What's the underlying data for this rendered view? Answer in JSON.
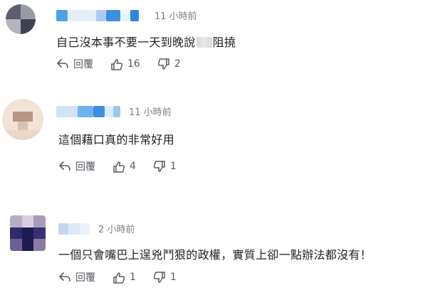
{
  "comments": [
    {
      "time": "11 小時前",
      "text_before": "自己沒本事不要一天到晚說",
      "text_after": "阻撓",
      "reply_label": "回覆",
      "likes": "16",
      "dislikes": "2"
    },
    {
      "time": "11 小時前",
      "text": "這個藉口真的非常好用",
      "reply_label": "回覆",
      "likes": "4",
      "dislikes": "1"
    },
    {
      "time": "2 小時前",
      "text": "一個只會嘴巴上逞兇鬥狠的政權，實質上卻一點辦法都沒有！",
      "reply_label": "回覆",
      "likes": "1",
      "dislikes": "1"
    }
  ],
  "colors": {
    "time_gray": "#7a7f86",
    "icon_gray": "#555a60",
    "blur_blue": "#4aa3e8",
    "blur_light": "#cfe3f7"
  },
  "icons": [
    "reply-icon",
    "thumbs-up-icon",
    "thumbs-down-icon"
  ]
}
